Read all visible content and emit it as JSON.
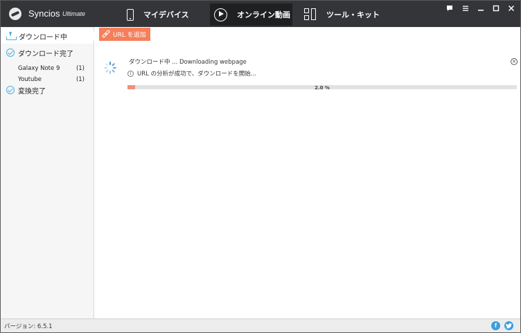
{
  "app": {
    "name": "Syncios",
    "edition": "Ultimate"
  },
  "nav": {
    "tabs": [
      {
        "label": "マイデバイス",
        "icon": "phone-icon"
      },
      {
        "label": "オンライン動画",
        "icon": "play-icon",
        "active": true
      },
      {
        "label": "ツール・キット",
        "icon": "toolkit-icon"
      }
    ]
  },
  "window_controls": [
    "feedback-icon",
    "menu-icon",
    "minimize-icon",
    "maximize-icon",
    "close-icon"
  ],
  "sidebar": {
    "downloading": "ダウンロード中",
    "downloaded": "ダウンロード完了",
    "sources": [
      {
        "name": "Galaxy Note 9",
        "count": "(1)"
      },
      {
        "name": "Youtube",
        "count": "(1)"
      }
    ],
    "converted": "変換完了"
  },
  "toolbar": {
    "add_url": "URL を追加"
  },
  "download": {
    "title": "ダウンロード中 ...   Downloading webpage",
    "status": "URL の分析が成功で、ダウンロードを開始...",
    "progress_text": "2.0 %",
    "progress_fraction": 0.02
  },
  "statusbar": {
    "version": "バージョン: 6.5.1"
  },
  "colors": {
    "accent_orange": "#f47f5a",
    "accent_blue": "#4aaee0",
    "titlebar": "#333538",
    "facebook": "#3aa0e0",
    "twitter": "#3aa0e0"
  }
}
